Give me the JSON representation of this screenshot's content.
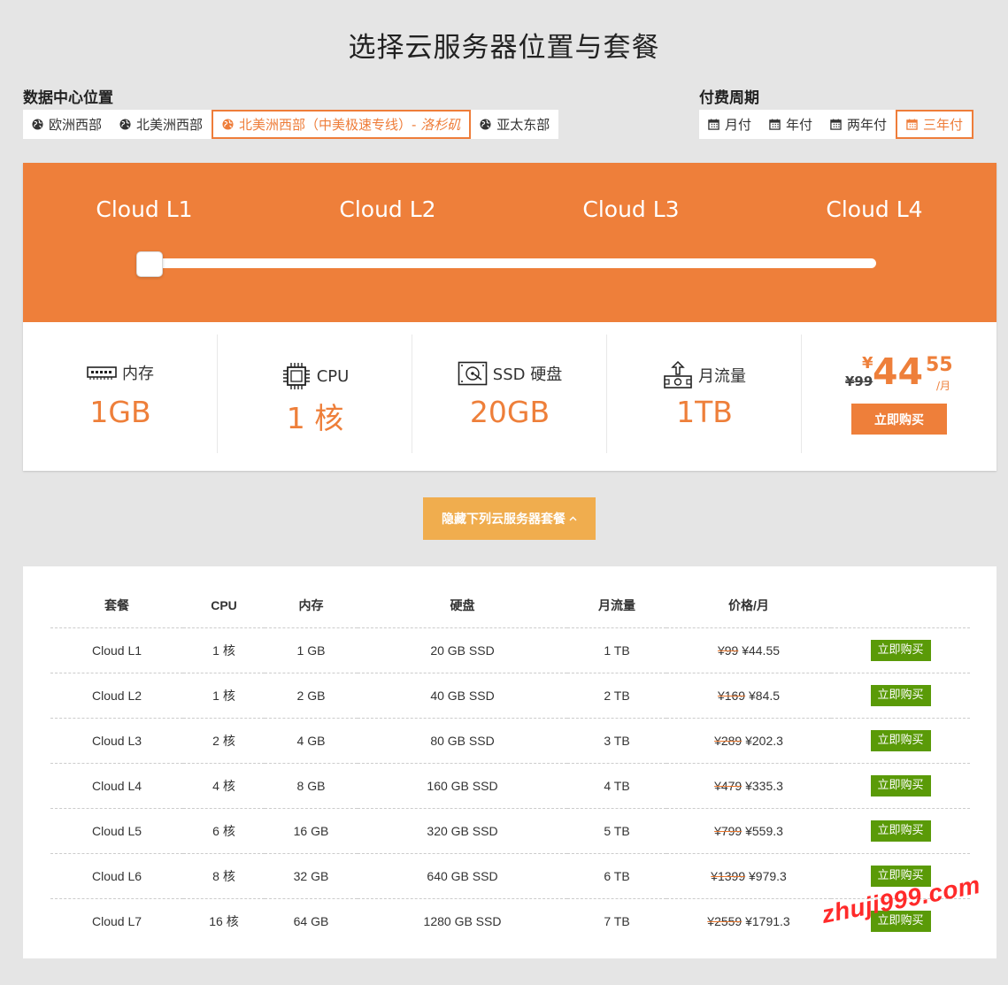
{
  "title": "选择云服务器位置与套餐",
  "datacenter": {
    "label": "数据中心位置",
    "options": [
      {
        "label": "欧洲西部",
        "city": ""
      },
      {
        "label": "北美洲西部",
        "city": ""
      },
      {
        "label": "北美洲西部（中美极速专线）- ",
        "city": "洛杉矶"
      },
      {
        "label": "亚太东部",
        "city": ""
      }
    ],
    "selected_index": 2
  },
  "billing": {
    "label": "付费周期",
    "options": [
      "月付",
      "年付",
      "两年付",
      "三年付"
    ],
    "selected_index": 3
  },
  "plans_slider": {
    "names": [
      "Cloud L1",
      "Cloud L2",
      "Cloud L3",
      "Cloud L4"
    ],
    "selected_index": 0
  },
  "selected_plan": {
    "memory_label": "内存",
    "memory": "1GB",
    "cpu_label": "CPU",
    "cpu": "1 核",
    "disk_label": "SSD 硬盘",
    "disk": "20GB",
    "traffic_label": "月流量",
    "traffic": "1TB",
    "old_price": "¥99",
    "currency": "¥",
    "price_int": "44",
    "price_dec": "55",
    "per": "/月",
    "buy": "立即购买"
  },
  "toggle_button": {
    "label": "隐藏下列云服务器套餐",
    "icon": "chevron-up-icon"
  },
  "table": {
    "headers": [
      "套餐",
      "CPU",
      "内存",
      "硬盘",
      "月流量",
      "价格/月",
      ""
    ],
    "rows": [
      {
        "name": "Cloud L1",
        "cpu": "1 核",
        "mem": "1 GB",
        "disk": "20 GB SSD",
        "traffic": "1 TB",
        "old": "¥99",
        "price": "¥44.55",
        "buy": "立即购买"
      },
      {
        "name": "Cloud L2",
        "cpu": "1 核",
        "mem": "2 GB",
        "disk": "40 GB SSD",
        "traffic": "2 TB",
        "old": "¥169",
        "price": "¥84.5",
        "buy": "立即购买"
      },
      {
        "name": "Cloud L3",
        "cpu": "2 核",
        "mem": "4 GB",
        "disk": "80 GB SSD",
        "traffic": "3 TB",
        "old": "¥289",
        "price": "¥202.3",
        "buy": "立即购买"
      },
      {
        "name": "Cloud L4",
        "cpu": "4 核",
        "mem": "8 GB",
        "disk": "160 GB SSD",
        "traffic": "4 TB",
        "old": "¥479",
        "price": "¥335.3",
        "buy": "立即购买"
      },
      {
        "name": "Cloud L5",
        "cpu": "6 核",
        "mem": "16 GB",
        "disk": "320 GB SSD",
        "traffic": "5 TB",
        "old": "¥799",
        "price": "¥559.3",
        "buy": "立即购买"
      },
      {
        "name": "Cloud L6",
        "cpu": "8 核",
        "mem": "32 GB",
        "disk": "640 GB SSD",
        "traffic": "6 TB",
        "old": "¥1399",
        "price": "¥979.3",
        "buy": "立即购买"
      },
      {
        "name": "Cloud L7",
        "cpu": "16 核",
        "mem": "64 GB",
        "disk": "1280 GB SSD",
        "traffic": "7 TB",
        "old": "¥2559",
        "price": "¥1791.3",
        "buy": "立即购买"
      }
    ]
  },
  "watermark": "zhuji999.com",
  "colors": {
    "accent": "#ee7f3a",
    "toggle": "#f0ad4e",
    "buy_green": "#5a9a08",
    "background": "#e5e5e5"
  }
}
